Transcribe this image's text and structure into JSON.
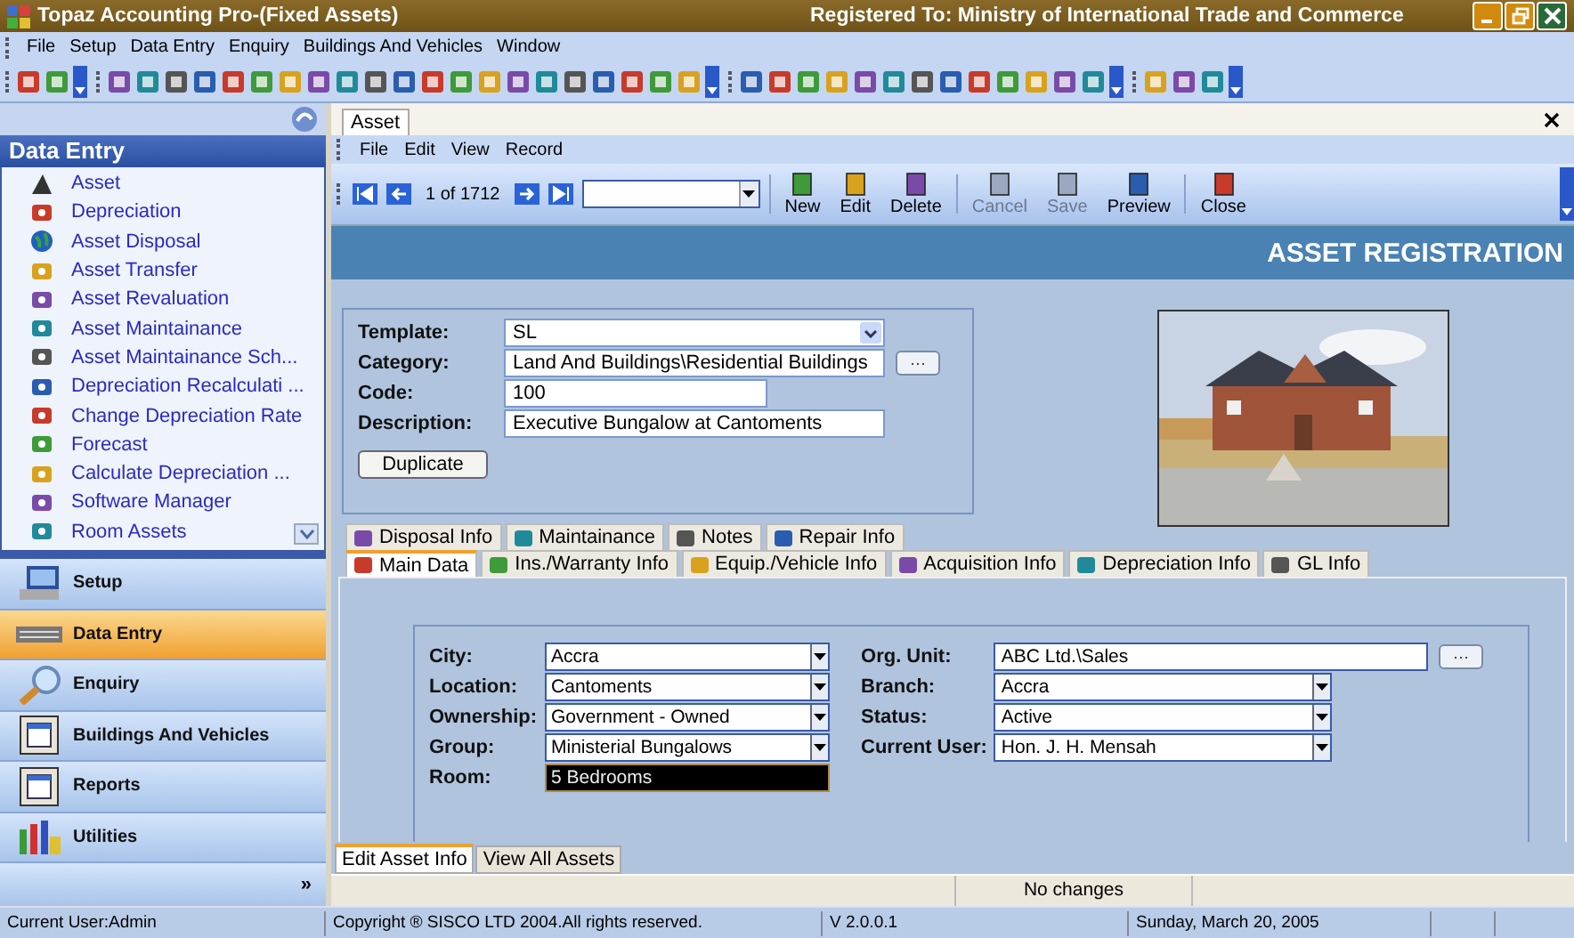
{
  "window": {
    "title": "Topaz Accounting Pro-(Fixed Assets)",
    "registration": "Registered To: Ministry of International Trade and Commerce"
  },
  "menu": [
    "File",
    "Setup",
    "Data Entry",
    "Enquiry",
    "Buildings And Vehicles",
    "Window"
  ],
  "sidebar": {
    "header": "Data Entry",
    "items": [
      {
        "label": "Asset"
      },
      {
        "label": "Depreciation"
      },
      {
        "label": "Asset Disposal"
      },
      {
        "label": "Asset Transfer"
      },
      {
        "label": "Asset Revaluation"
      },
      {
        "label": "Asset Maintainance"
      },
      {
        "label": "Asset Maintainance Sch..."
      },
      {
        "label": "Depreciation  Recalculati ..."
      },
      {
        "label": "Change Depreciation Rate"
      },
      {
        "label": "Forecast"
      },
      {
        "label": "Calculate  Depreciation ..."
      },
      {
        "label": "Software Manager"
      },
      {
        "label": "Room Assets"
      }
    ],
    "nav": [
      {
        "label": "Setup",
        "selected": false
      },
      {
        "label": "Data Entry",
        "selected": true
      },
      {
        "label": "Enquiry",
        "selected": false
      },
      {
        "label": "Buildings And Vehicles",
        "selected": false
      },
      {
        "label": "Reports",
        "selected": false
      },
      {
        "label": "Utilities",
        "selected": false
      }
    ]
  },
  "sidebar_more": "»",
  "document_tabs": [
    {
      "label": "Asset",
      "selected": true
    }
  ],
  "form_menu": [
    "File",
    "Edit",
    "View",
    "Record"
  ],
  "record_nav": {
    "position": "1 of 1712"
  },
  "form_toolbar": [
    {
      "label": "New",
      "disabled": false
    },
    {
      "label": "Edit",
      "disabled": false
    },
    {
      "label": "Delete",
      "disabled": false
    },
    {
      "label": "Cancel",
      "disabled": true
    },
    {
      "label": "Save",
      "disabled": true
    },
    {
      "label": "Preview",
      "disabled": false
    },
    {
      "label": "Close",
      "disabled": false
    }
  ],
  "banner": "ASSET REGISTRATION",
  "header_fields": [
    {
      "label": "Template:",
      "value": "SL",
      "kind": "dropdown"
    },
    {
      "label": "Category:",
      "value": "Land And Buildings\\Residential Buildings",
      "kind": "browse"
    },
    {
      "label": "Code:",
      "value": "100",
      "kind": "short"
    },
    {
      "label": "Description:",
      "value": "Executive Bungalow at Cantoments",
      "kind": "text"
    }
  ],
  "duplicate_button": "Duplicate",
  "tabs_row_1": [
    {
      "label": "Disposal Info",
      "selected": false
    },
    {
      "label": "Maintainance",
      "selected": false
    },
    {
      "label": "Notes",
      "selected": false
    },
    {
      "label": "Repair Info",
      "selected": false
    }
  ],
  "tabs_row_2": [
    {
      "label": "Main Data",
      "selected": true
    },
    {
      "label": "Ins./Warranty Info",
      "selected": false
    },
    {
      "label": "Equip./Vehicle Info",
      "selected": false
    },
    {
      "label": "Acquisition Info",
      "selected": false
    },
    {
      "label": "Depreciation Info",
      "selected": false
    },
    {
      "label": "GL Info",
      "selected": false
    }
  ],
  "main_fields_left": [
    {
      "label": "City:",
      "value": "Accra",
      "kind": "dropdown"
    },
    {
      "label": "Location:",
      "value": "Cantoments",
      "kind": "dropdown"
    },
    {
      "label": "Ownership:",
      "value": "Government - Owned",
      "kind": "dropdown"
    },
    {
      "label": "Group:",
      "value": "Ministerial Bungalows",
      "kind": "dropdown"
    },
    {
      "label": "Room:",
      "value": "5 Bedrooms",
      "kind": "focused"
    }
  ],
  "main_fields_right": [
    {
      "label": "Org. Unit:",
      "value": "ABC Ltd.\\Sales",
      "kind": "browse"
    },
    {
      "label": "Branch:",
      "value": "Accra",
      "kind": "dropdown"
    },
    {
      "label": "Status:",
      "value": "Active",
      "kind": "dropdown"
    },
    {
      "label": "Current User:",
      "value": "Hon. J. H. Mensah",
      "kind": "dropdown"
    }
  ],
  "bottom_tabs": [
    {
      "label": "Edit Asset Info",
      "selected": true
    },
    {
      "label": "View All Assets",
      "selected": false
    }
  ],
  "status_message": "No changes",
  "status_bar": [
    "Current User:Admin",
    "Copyright ® SISCO LTD 2004.All rights reserved.",
    "V 2.0.0.1",
    "Sunday, March 20, 2005"
  ]
}
